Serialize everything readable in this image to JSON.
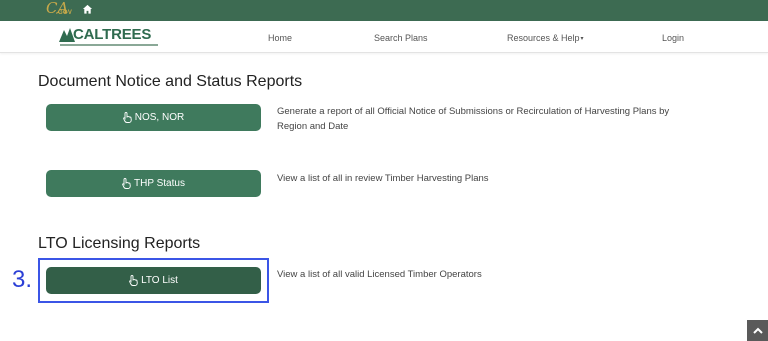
{
  "topbar": {
    "ca_logo": {
      "main": "CA",
      "sub": ".GOV"
    },
    "home_icon": "home-icon"
  },
  "navbar": {
    "brand": "CALTREES",
    "links": {
      "home": "Home",
      "search": "Search Plans",
      "resources": "Resources & Help",
      "login": "Login"
    }
  },
  "sections": {
    "doc": {
      "title": "Document Notice and Status Reports",
      "items": [
        {
          "button": "NOS, NOR",
          "desc_line1": "Generate a report of all Official Notice of Submissions or Recirculation of Harvesting Plans by",
          "desc_line2": "Region and Date"
        },
        {
          "button": "THP Status",
          "desc_line1": "View a list of all in review Timber Harvesting Plans"
        }
      ]
    },
    "lto": {
      "title": "LTO Licensing Reports",
      "items": [
        {
          "button": "LTO List",
          "desc_line1": "View a list of all valid Licensed Timber Operators"
        }
      ]
    }
  },
  "annotation": {
    "step_number": "3.",
    "highlight_color": "#3b55e6"
  },
  "colors": {
    "topbar": "#3d6b52",
    "button": "#3f7a5d",
    "brand": "#2f6b4f"
  },
  "back_to_top_icon": "chevron-up-icon"
}
